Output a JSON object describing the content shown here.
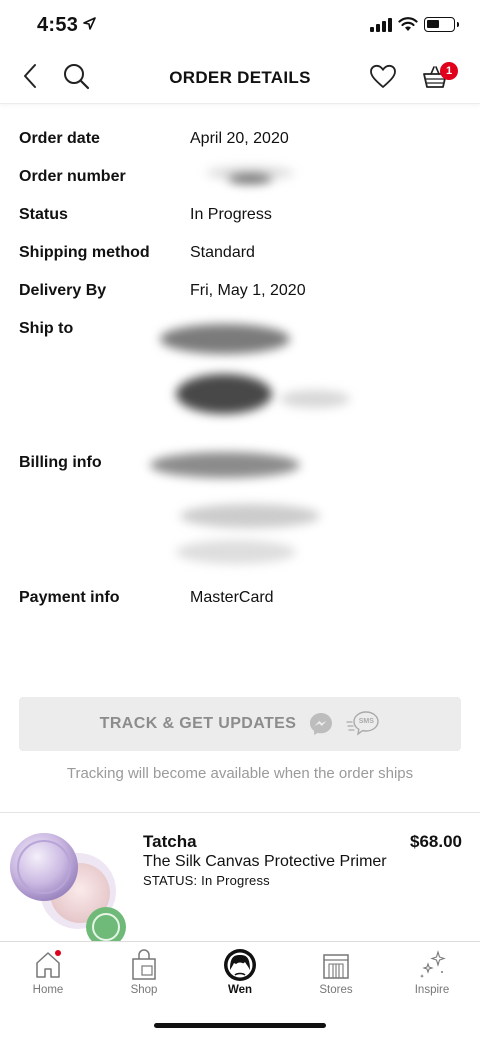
{
  "status_bar": {
    "time": "4:53"
  },
  "header": {
    "title": "ORDER DETAILS",
    "cart_count": "1"
  },
  "details": {
    "order_date": {
      "label": "Order date",
      "value": "April 20, 2020"
    },
    "order_number": {
      "label": "Order number"
    },
    "status": {
      "label": "Status",
      "value": "In Progress"
    },
    "shipping_method": {
      "label": "Shipping method",
      "value": "Standard"
    },
    "delivery_by": {
      "label": "Delivery By",
      "value": "Fri, May 1, 2020"
    },
    "ship_to": {
      "label": "Ship to"
    },
    "billing_info": {
      "label": "Billing info"
    },
    "payment_info": {
      "label": "Payment info",
      "value": "MasterCard"
    }
  },
  "tracking": {
    "button_label": "TRACK & GET UPDATES",
    "sms_label": "SMS",
    "note": "Tracking will become available when the order ships"
  },
  "product": {
    "brand": "Tatcha",
    "name": "The Silk Canvas Protective Primer",
    "status": "STATUS: In Progress",
    "price": "$68.00"
  },
  "tabs": [
    {
      "label": "Home",
      "icon": "home-icon"
    },
    {
      "label": "Shop",
      "icon": "shopping-bag-icon"
    },
    {
      "label": "Wen",
      "icon": "profile-avatar-icon"
    },
    {
      "label": "Stores",
      "icon": "storefront-icon"
    },
    {
      "label": "Inspire",
      "icon": "sparkle-icon"
    }
  ],
  "colors": {
    "badge_red": "#e0001b",
    "track_button_bg": "#ececec",
    "muted_text": "#9a9a9a"
  }
}
